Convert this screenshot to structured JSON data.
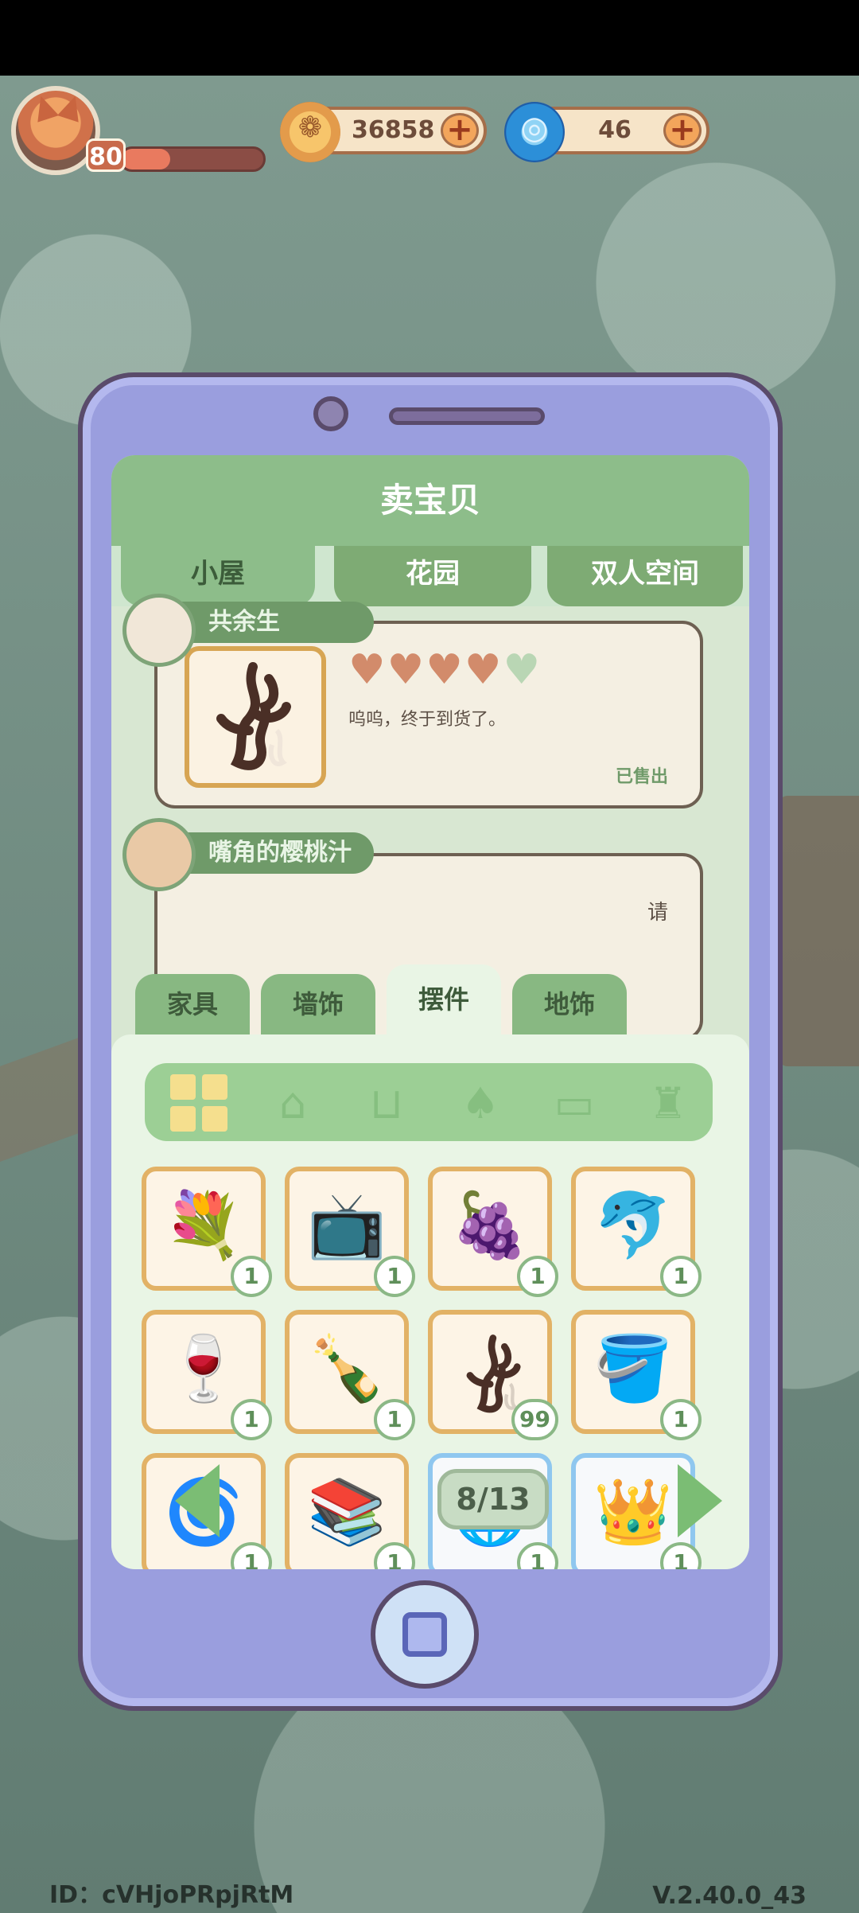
{
  "player": {
    "level": "80",
    "xp_fraction": 0.34
  },
  "currency": {
    "coins": "36858",
    "gems": "46"
  },
  "sell_panel": {
    "title": "卖宝贝",
    "tabs": [
      {
        "label": "小屋",
        "active": true
      },
      {
        "label": "花园",
        "active": false
      },
      {
        "label": "双人空间",
        "active": false
      }
    ],
    "records": [
      {
        "name": "共余生",
        "rating": 4,
        "max_rating": 5,
        "message": "呜呜，终于到货了。",
        "status": "已售出"
      },
      {
        "name": "嘴角的樱桃汁",
        "partial_text": "请"
      }
    ]
  },
  "inventory": {
    "categories": [
      {
        "label": "家具",
        "active": false
      },
      {
        "label": "墙饰",
        "active": false
      },
      {
        "label": "摆件",
        "active": true
      },
      {
        "label": "地饰",
        "active": false
      }
    ],
    "filters": [
      {
        "icon": "grid-all-icon",
        "active": true
      },
      {
        "icon": "pot-icon",
        "active": false
      },
      {
        "icon": "cup-icon",
        "active": false
      },
      {
        "icon": "lamp-icon",
        "active": false
      },
      {
        "icon": "frame-icon",
        "active": false
      },
      {
        "icon": "vase-icon",
        "active": false
      }
    ],
    "items": [
      {
        "icon": "flower-basket-icon",
        "count": "1",
        "rarity": "common"
      },
      {
        "icon": "tv-icon",
        "count": "1",
        "rarity": "common"
      },
      {
        "icon": "fruit-plate-icon",
        "count": "1",
        "rarity": "common"
      },
      {
        "icon": "dolphin-icon",
        "count": "1",
        "rarity": "common"
      },
      {
        "icon": "wine-bottle-icon",
        "count": "1",
        "rarity": "common"
      },
      {
        "icon": "oil-bottles-icon",
        "count": "1",
        "rarity": "common"
      },
      {
        "icon": "driftwood-icon",
        "count": "99",
        "rarity": "common"
      },
      {
        "icon": "water-dispenser-icon",
        "count": "1",
        "rarity": "common"
      },
      {
        "icon": "fan-icon",
        "count": "1",
        "rarity": "common"
      },
      {
        "icon": "books-icon",
        "count": "1",
        "rarity": "common"
      },
      {
        "icon": "globe-icon",
        "count": "1",
        "rarity": "rare"
      },
      {
        "icon": "crown-icon",
        "count": "1",
        "rarity": "rare"
      }
    ],
    "page": "8/13"
  },
  "footer": {
    "id": "ID：cVHjoPRpjRtM",
    "version": "V.2.40.0_43"
  }
}
